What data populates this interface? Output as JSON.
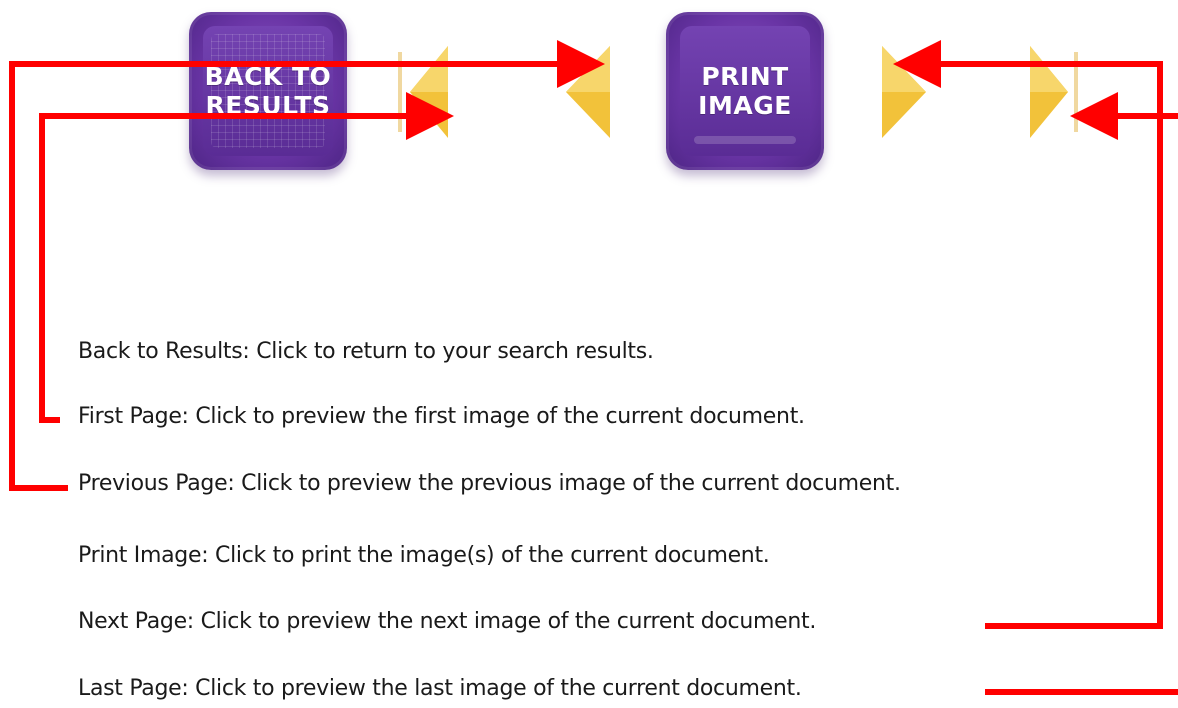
{
  "toolbar": {
    "back_to_results": {
      "line1": "BACK TO",
      "line2": "RESULTS"
    },
    "print_image": {
      "line1": "PRINT",
      "line2": "IMAGE"
    },
    "arrow_color": "#f2c23a"
  },
  "descriptions": [
    "Back to Results: Click to return to your search results.",
    "First Page:  Click to preview the first image of the current document.",
    "Previous Page: Click to preview the previous image of the current document.",
    "Print Image: Click to print the image(s) of the current document.",
    "Next Page: Click to preview the next image of the current document.",
    "Last Page: Click to preview the last image of the current document."
  ],
  "connector_color": "#ff0000",
  "button_color": "#6a35a6"
}
